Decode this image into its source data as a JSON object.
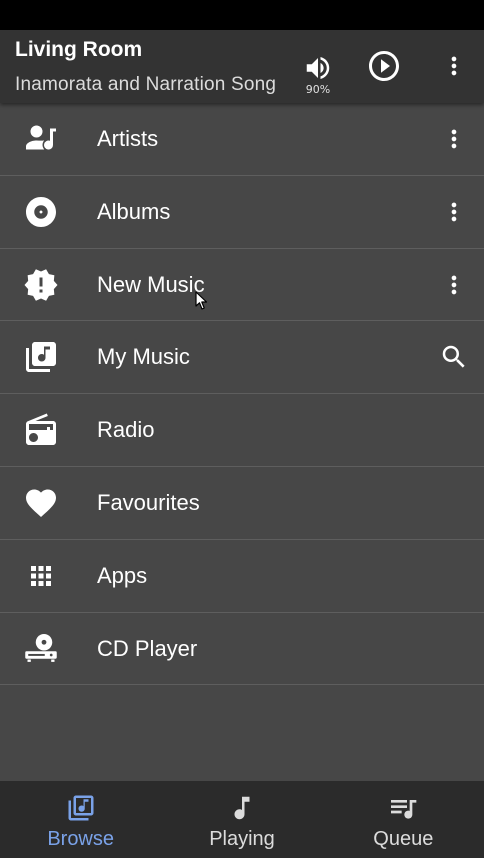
{
  "toolbar": {
    "title": "Living Room",
    "subtitle": "Inamorata and Narration Song",
    "volume_icon": "volume-up-icon",
    "volume_percent": "90%",
    "play_icon": "play-circle-icon",
    "menu_icon": "more-vert-icon"
  },
  "browse_items": [
    {
      "label": "Artists",
      "icon": "artist-icon",
      "action_icon": "more-vert-icon"
    },
    {
      "label": "Albums",
      "icon": "album-disc-icon",
      "action_icon": "more-vert-icon"
    },
    {
      "label": "New Music",
      "icon": "new-releases-icon",
      "action_icon": "more-vert-icon"
    },
    {
      "label": "My Music",
      "icon": "library-music-icon",
      "action_icon": "search-icon"
    },
    {
      "label": "Radio",
      "icon": "radio-icon",
      "action_icon": ""
    },
    {
      "label": "Favourites",
      "icon": "heart-icon",
      "action_icon": ""
    },
    {
      "label": "Apps",
      "icon": "apps-grid-icon",
      "action_icon": ""
    },
    {
      "label": "CD Player",
      "icon": "cd-player-icon",
      "action_icon": ""
    }
  ],
  "bottom_nav": {
    "items": [
      {
        "label": "Browse",
        "icon": "library-music-icon",
        "active": true
      },
      {
        "label": "Playing",
        "icon": "music-note-icon",
        "active": false
      },
      {
        "label": "Queue",
        "icon": "queue-music-icon",
        "active": false
      }
    ]
  },
  "colors": {
    "toolbar_bg": "#333333",
    "list_bg": "#474747",
    "divider": "#5e5e5e",
    "nav_bg": "#2b2b2b",
    "active_accent": "#7aa2e8",
    "text": "#ffffff"
  }
}
